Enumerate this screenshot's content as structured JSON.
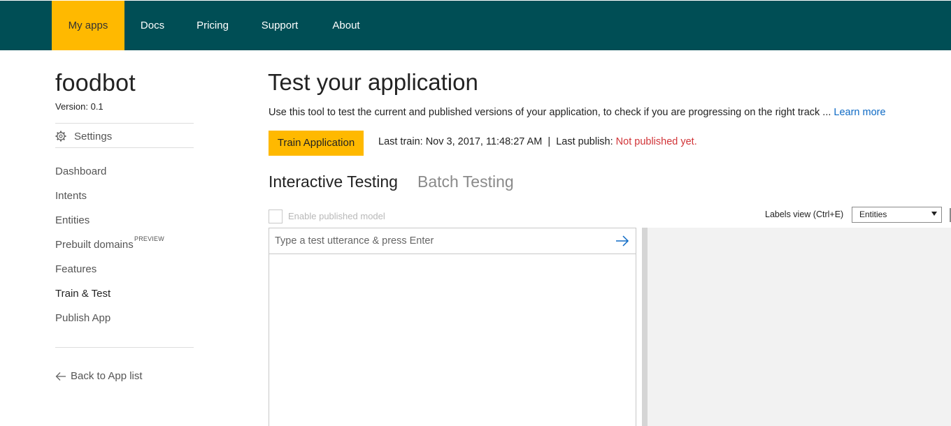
{
  "nav": {
    "items": [
      {
        "label": "My apps",
        "active": true
      },
      {
        "label": "Docs",
        "active": false
      },
      {
        "label": "Pricing",
        "active": false
      },
      {
        "label": "Support",
        "active": false
      },
      {
        "label": "About",
        "active": false
      }
    ],
    "colors": {
      "bar": "#004e55",
      "active": "#ffb900"
    }
  },
  "sidebar": {
    "app_name": "foodbot",
    "version_text": "Version:  0.1",
    "settings_label": "Settings",
    "settings_icon": "gear-icon",
    "items": [
      {
        "label": "Dashboard",
        "active": false
      },
      {
        "label": "Intents",
        "active": false
      },
      {
        "label": "Entities",
        "active": false
      },
      {
        "label": "Prebuilt domains",
        "active": false,
        "tag": "PREVIEW"
      },
      {
        "label": "Features",
        "active": false
      },
      {
        "label": "Train & Test",
        "active": true
      },
      {
        "label": "Publish App",
        "active": false
      }
    ],
    "back_label": "Back to App list",
    "back_icon": "arrow-left-icon"
  },
  "main": {
    "title": "Test your application",
    "description": "Use this tool to test the current and published versions of your application, to check if you are progressing on the right track ...",
    "learn_more": "Learn more",
    "train_button": "Train Application",
    "last_train_label": "Last train:",
    "last_train_value": "Nov 3, 2017, 11:48:27 AM",
    "separator": "|",
    "last_publish_label": "Last publish:",
    "last_publish_value": "Not published yet.",
    "tabs": [
      {
        "label": "Interactive Testing",
        "active": true
      },
      {
        "label": "Batch Testing",
        "active": false
      }
    ],
    "enable_published_label": "Enable published model",
    "enable_published_checked": false,
    "labels_view_label": "Labels view (Ctrl+E)",
    "labels_view_value": "Entities",
    "utterance_placeholder": "Type a test utterance & press Enter",
    "send_icon": "arrow-right-icon",
    "colors": {
      "link": "#0e6ac5",
      "warning": "#d13438",
      "button": "#ffb900"
    }
  }
}
